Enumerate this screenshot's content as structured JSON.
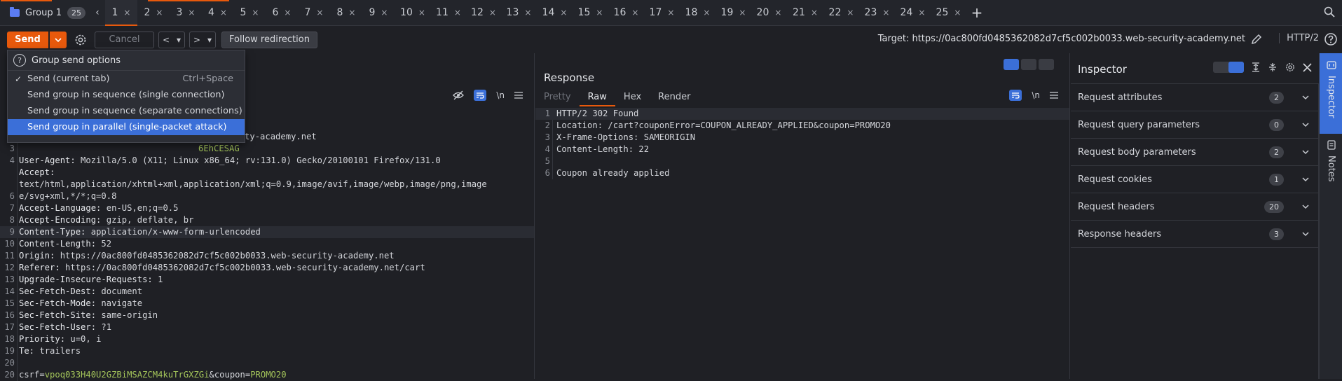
{
  "tabbar": {
    "group_label": "Group 1",
    "group_count": "25",
    "tabs": [
      "1",
      "2",
      "3",
      "4",
      "5",
      "6",
      "7",
      "8",
      "9",
      "10",
      "11",
      "12",
      "13",
      "14",
      "15",
      "16",
      "17",
      "18",
      "19",
      "20",
      "21",
      "22",
      "23",
      "24",
      "25"
    ],
    "active_tab": "1",
    "close_glyph": "×",
    "add_glyph": "+",
    "scroll_left_glyph": "‹",
    "accent_color": "#e8590c"
  },
  "toolbar": {
    "send_label": "Send",
    "cancel_label": "Cancel",
    "back_glyph": "<",
    "forward_glyph": ">",
    "drop_glyph": "▾",
    "follow_label": "Follow redirection",
    "target_text": "Target: https://0ac800fd0485362082d7cf5c002b0033.web-security-academy.net",
    "protocol_label": "HTTP/2"
  },
  "menu": {
    "header": "Group send options",
    "items": [
      {
        "label": "Send (current tab)",
        "shortcut": "Ctrl+Space",
        "checked": "✓"
      },
      {
        "label": "Send group in sequence (single connection)"
      },
      {
        "label": "Send group in sequence (separate connections)"
      },
      {
        "label": "Send group in parallel (single-packet attack)"
      }
    ]
  },
  "request": {
    "line_numbers": [
      "1",
      "2",
      "3",
      "4",
      "",
      "",
      "6",
      "7",
      "8",
      "9",
      "10",
      "11",
      "12",
      "13",
      "14",
      "15",
      "16",
      "17",
      "18",
      "19",
      "20"
    ],
    "lines": [
      {
        "key": "",
        "val": ""
      },
      {
        "key": "",
        "val": "eb-security-academy.net"
      },
      {
        "key": "",
        "val": "6EhCESAG"
      },
      {
        "key": "User-Agent:",
        "val": " Mozilla/5.0 (X11; Linux x86_64; rv:131.0) Gecko/20100101 Firefox/131.0"
      },
      {
        "key": "Accept:",
        "val": ""
      },
      {
        "key": "",
        "val": "text/html,application/xhtml+xml,application/xml;q=0.9,image/avif,image/webp,image/png,image"
      },
      {
        "key": "",
        "val": "e/svg+xml,*/*;q=0.8"
      },
      {
        "key": "Accept-Language:",
        "val": " en-US,en;q=0.5"
      },
      {
        "key": "Accept-Encoding:",
        "val": " gzip, deflate, br"
      },
      {
        "key": "Content-Type:",
        "val": " application/x-www-form-urlencoded"
      },
      {
        "key": "Content-Length:",
        "val": " 52"
      },
      {
        "key": "Origin:",
        "val": " https://0ac800fd0485362082d7cf5c002b0033.web-security-academy.net"
      },
      {
        "key": "Referer:",
        "val": " https://0ac800fd0485362082d7cf5c002b0033.web-security-academy.net/cart"
      },
      {
        "key": "Upgrade-Insecure-Requests:",
        "val": " 1"
      },
      {
        "key": "Sec-Fetch-Dest:",
        "val": " document"
      },
      {
        "key": "Sec-Fetch-Mode:",
        "val": " navigate"
      },
      {
        "key": "Sec-Fetch-Site:",
        "val": " same-origin"
      },
      {
        "key": "Sec-Fetch-User:",
        "val": " ?1"
      },
      {
        "key": "Priority:",
        "val": " u=0, i"
      },
      {
        "key": "Te:",
        "val": " trailers"
      },
      {
        "key": "",
        "val": ""
      }
    ],
    "body": {
      "k1": "csrf=",
      "v1": "vpoq033H40U2GZBiMSAZCM4kuTrGXZGi",
      "k2": "&coupon=",
      "v2": "PROMO20"
    },
    "line_numbers_tail": [
      "19",
      "20"
    ],
    "tool_newline": "\\n"
  },
  "response": {
    "title": "Response",
    "tabs": [
      "Pretty",
      "Raw",
      "Hex",
      "Render"
    ],
    "active_tab": "Raw",
    "line_numbers": [
      "1",
      "2",
      "3",
      "4",
      "5",
      "6"
    ],
    "lines": [
      "HTTP/2 302 Found",
      "Location: /cart?couponError=COUPON_ALREADY_APPLIED&coupon=PROMO20",
      "X-Frame-Options: SAMEORIGIN",
      "Content-Length: 22",
      "",
      "Coupon already applied"
    ],
    "tool_newline": "\\n"
  },
  "inspector": {
    "title": "Inspector",
    "rows": [
      {
        "label": "Request attributes",
        "count": "2"
      },
      {
        "label": "Request query parameters",
        "count": "0"
      },
      {
        "label": "Request body parameters",
        "count": "2"
      },
      {
        "label": "Request cookies",
        "count": "1"
      },
      {
        "label": "Request headers",
        "count": "20"
      },
      {
        "label": "Response headers",
        "count": "3"
      }
    ]
  },
  "sidebar": {
    "inspector_label": "Inspector",
    "notes_label": "Notes"
  }
}
